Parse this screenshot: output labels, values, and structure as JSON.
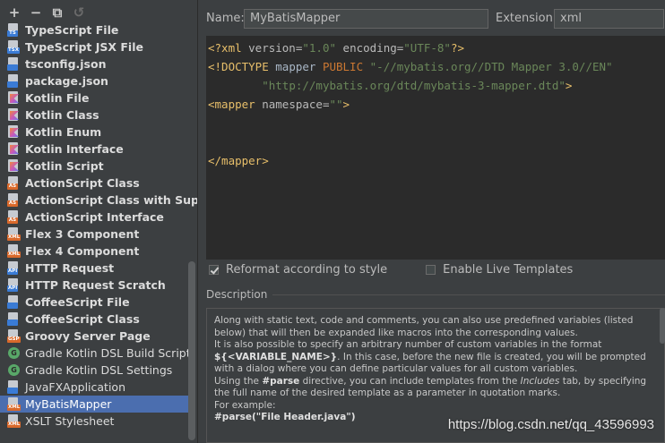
{
  "toolbar": {
    "add": "+",
    "remove": "−",
    "copy": "⧉",
    "reset": "↺"
  },
  "templates": [
    {
      "label": "TypeScript File",
      "icon": "ts",
      "tag": "TS",
      "bold": true,
      "color": "#3a7bd5"
    },
    {
      "label": "TypeScript JSX File",
      "icon": "tsx",
      "tag": "TSX",
      "bold": true,
      "color": "#3a7bd5"
    },
    {
      "label": "tsconfig.json",
      "icon": "json",
      "tag": "",
      "bold": true,
      "color": "#3a7bd5"
    },
    {
      "label": "package.json",
      "icon": "json",
      "tag": "",
      "bold": true,
      "color": "#3a7bd5"
    },
    {
      "label": "Kotlin File",
      "icon": "kotlin",
      "tag": "",
      "bold": true,
      "color": ""
    },
    {
      "label": "Kotlin Class",
      "icon": "kotlin",
      "tag": "",
      "bold": true,
      "color": ""
    },
    {
      "label": "Kotlin Enum",
      "icon": "kotlin",
      "tag": "",
      "bold": true,
      "color": ""
    },
    {
      "label": "Kotlin Interface",
      "icon": "kotlin",
      "tag": "",
      "bold": true,
      "color": ""
    },
    {
      "label": "Kotlin Script",
      "icon": "kotlin",
      "tag": "",
      "bold": true,
      "color": ""
    },
    {
      "label": "ActionScript Class",
      "icon": "as",
      "tag": "AS",
      "bold": true,
      "color": "#d9692b"
    },
    {
      "label": "ActionScript Class with Supers",
      "icon": "as",
      "tag": "AS",
      "bold": true,
      "color": "#d9692b"
    },
    {
      "label": "ActionScript Interface",
      "icon": "as",
      "tag": "AS",
      "bold": true,
      "color": "#d9692b"
    },
    {
      "label": "Flex 3 Component",
      "icon": "mxml",
      "tag": "XML",
      "bold": true,
      "color": "#d9692b"
    },
    {
      "label": "Flex 4 Component",
      "icon": "mxml",
      "tag": "XML",
      "bold": true,
      "color": "#d9692b"
    },
    {
      "label": "HTTP Request",
      "icon": "api",
      "tag": "API",
      "bold": true,
      "color": "#3a7bd5"
    },
    {
      "label": "HTTP Request Scratch",
      "icon": "api",
      "tag": "API",
      "bold": true,
      "color": "#3a7bd5"
    },
    {
      "label": "CoffeeScript File",
      "icon": "coffee",
      "tag": "",
      "bold": true,
      "color": "#3a7bd5"
    },
    {
      "label": "CoffeeScript Class",
      "icon": "coffee",
      "tag": "",
      "bold": true,
      "color": "#3a7bd5"
    },
    {
      "label": "Groovy Server Page",
      "icon": "gsp",
      "tag": "GSP",
      "bold": true,
      "color": "#d9692b"
    },
    {
      "label": "Gradle Kotlin DSL Build Script",
      "icon": "gradle",
      "tag": "G",
      "bold": false,
      "color": "#59a869"
    },
    {
      "label": "Gradle Kotlin DSL Settings",
      "icon": "gradle",
      "tag": "G",
      "bold": false,
      "color": "#59a869"
    },
    {
      "label": "JavaFXApplication",
      "icon": "java",
      "tag": "",
      "bold": false,
      "color": "#3a7bd5"
    },
    {
      "label": "MyBatisMapper",
      "icon": "xml",
      "tag": "XML",
      "bold": false,
      "color": "#d9692b",
      "selected": true
    },
    {
      "label": "XSLT Stylesheet",
      "icon": "xml",
      "tag": "XML",
      "bold": false,
      "color": "#d9692b"
    }
  ],
  "form": {
    "name_label": "Name:",
    "name_value": "MyBatisMapper",
    "extension_label": "Extension:",
    "extension_value": "xml"
  },
  "code_lines": [
    [
      [
        "pi",
        "<?xml "
      ],
      [
        "at",
        "version="
      ],
      [
        "sv",
        "\"1.0\""
      ],
      [
        "at",
        " encoding="
      ],
      [
        "sv",
        "\"UTF-8\""
      ],
      [
        "pi",
        "?>"
      ]
    ],
    [
      [
        "tg",
        "<!DOCTYPE "
      ],
      [
        "tx",
        "mapper "
      ],
      [
        "kw",
        "PUBLIC "
      ],
      [
        "sv",
        "\"-//mybatis.org//DTD Mapper 3.0//EN\""
      ]
    ],
    [
      [
        "tx",
        "        "
      ],
      [
        "sv",
        "\"http://mybatis.org/dtd/mybatis-3-mapper.dtd\""
      ],
      [
        "tg",
        ">"
      ]
    ],
    [
      [
        "tg",
        "<mapper "
      ],
      [
        "at",
        "namespace="
      ],
      [
        "sv",
        "\"\""
      ],
      [
        "tg",
        ">"
      ]
    ],
    [],
    [],
    [
      [
        "tg",
        "</mapper>"
      ]
    ]
  ],
  "options": {
    "reformat_label": "Reformat according to style",
    "reformat_checked": true,
    "live_templates_label": "Enable Live Templates",
    "live_templates_checked": false
  },
  "description": {
    "heading": "Description",
    "p1": "Along with static text, code and comments, you can also use predefined variables (listed below) that will then be expanded like macros into the corresponding values.",
    "p2a": "It is also possible to specify an arbitrary number of custom variables in the format ",
    "p2var": "${<VARIABLE_NAME>}",
    "p2b": ". In this case, before the new file is created, you will be prompted with a dialog where you can define particular values for all custom variables.",
    "p3a": "Using the ",
    "p3kw": "#parse",
    "p3b": " directive, you can include templates from the ",
    "p3it": "Includes",
    "p3c": " tab, by specifying the full name of the desired template as a parameter in quotation marks.",
    "p4": "For example:",
    "p5": "#parse(\"File Header.java\")"
  },
  "watermark": "https://blog.csdn.net/qq_43596993"
}
